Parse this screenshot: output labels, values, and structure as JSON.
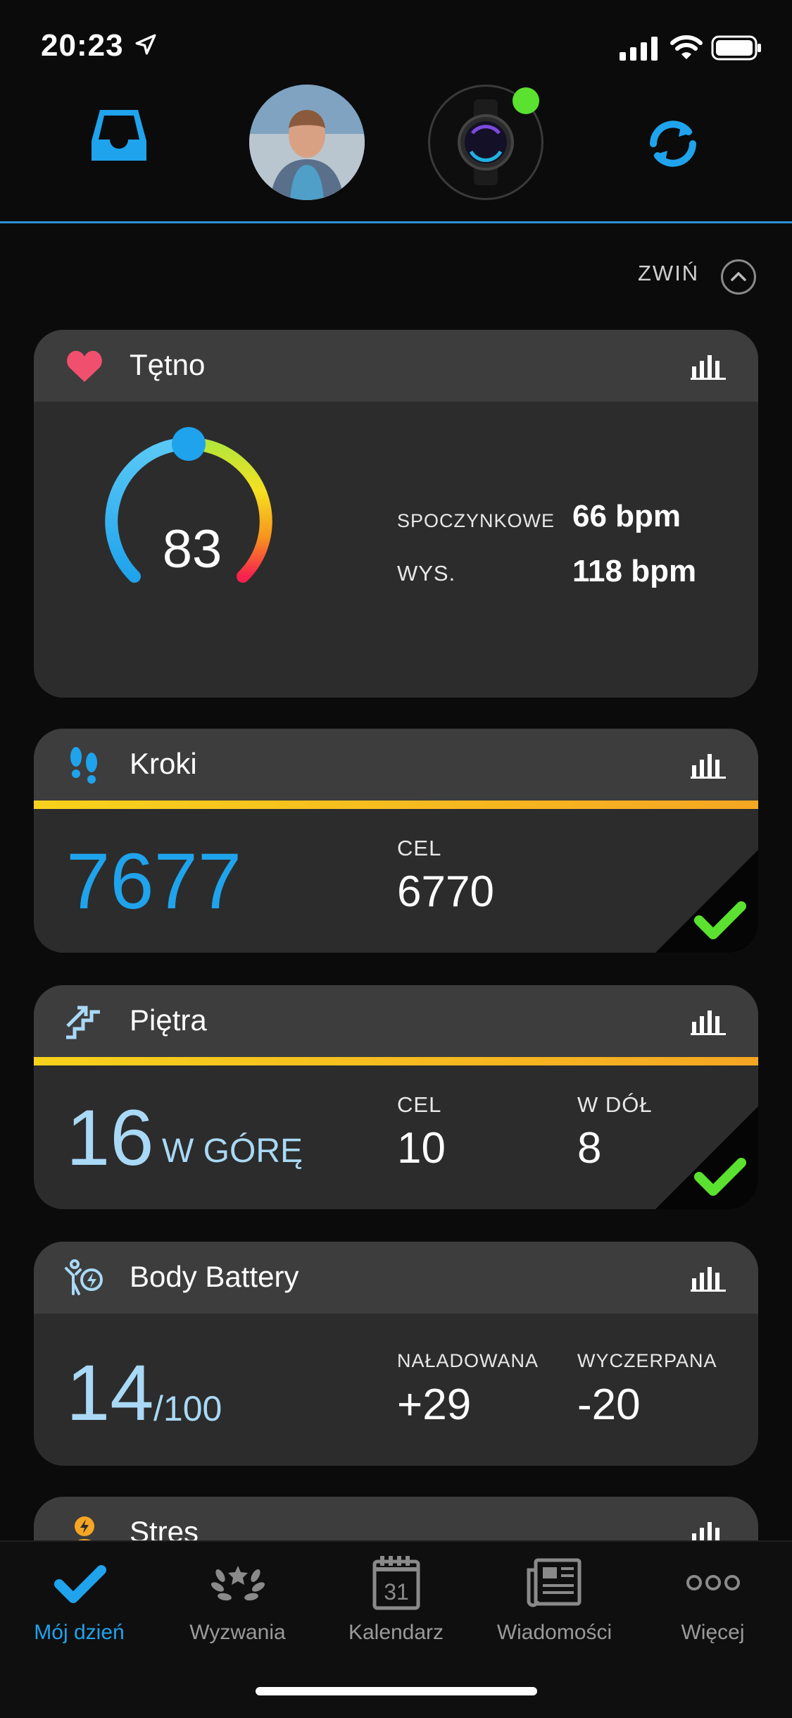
{
  "status_bar": {
    "time": "20:23"
  },
  "header": {
    "collapse_label": "ZWIŃ"
  },
  "heart_rate": {
    "title": "Tętno",
    "current": "83",
    "resting_label": "SPOCZYNKOWE",
    "resting_value": "66 bpm",
    "high_label": "WYS.",
    "high_value": "118 bpm"
  },
  "steps": {
    "title": "Kroki",
    "value": "7677",
    "goal_label": "CEL",
    "goal_value": "6770",
    "progress": 1.0
  },
  "floors": {
    "title": "Piętra",
    "up_value": "16",
    "up_label": "W GÓRĘ",
    "goal_label": "CEL",
    "goal_value": "10",
    "down_label": "W DÓŁ",
    "down_value": "8",
    "progress": 1.0
  },
  "body_battery": {
    "title": "Body Battery",
    "value": "14",
    "max": "/100",
    "charged_label": "NAŁADOWANA",
    "charged_value": "+29",
    "drained_label": "WYCZERPANA",
    "drained_value": "-20"
  },
  "stress": {
    "title": "Stres"
  },
  "tabs": [
    {
      "label": "Mój dzień",
      "icon": "check-icon",
      "active": true
    },
    {
      "label": "Wyzwania",
      "icon": "laurel-icon",
      "active": false
    },
    {
      "label": "Kalendarz",
      "icon": "calendar-icon",
      "active": false
    },
    {
      "label": "Wiadomości",
      "icon": "news-icon",
      "active": false
    },
    {
      "label": "Więcej",
      "icon": "more-icon",
      "active": false
    }
  ],
  "calendar_day": "31",
  "colors": {
    "accent": "#1fa3ec",
    "progress": "#f7c51c",
    "check": "#5be12f",
    "heart": "#f0506e",
    "light_blue_value": "#a9d9f6"
  }
}
